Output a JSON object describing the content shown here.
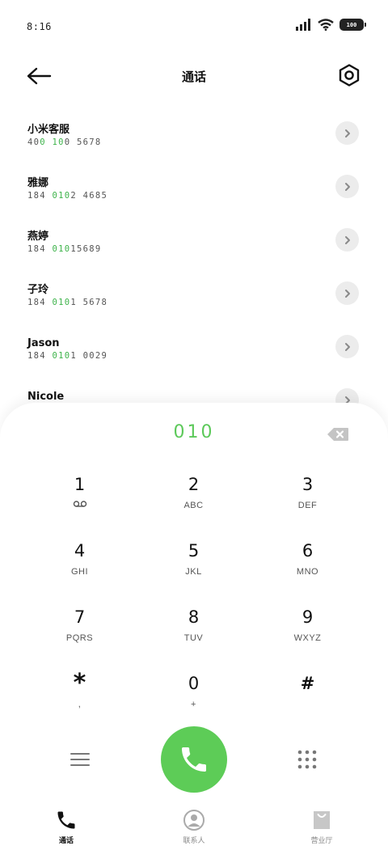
{
  "status": {
    "time": "8:16",
    "battery": "100"
  },
  "header": {
    "title": "通话"
  },
  "contacts": [
    {
      "name": "小米客服",
      "number_pre": "40",
      "number_hl": "0 10",
      "number_post": "0 5678"
    },
    {
      "name": "雅娜",
      "number_pre": "184 ",
      "number_hl": "010",
      "number_post": "2 4685"
    },
    {
      "name": "燕婷",
      "number_pre": "184 ",
      "number_hl": "010",
      "number_post": "15689"
    },
    {
      "name": "子玲",
      "number_pre": "184 ",
      "number_hl": "010",
      "number_post": "1 5678"
    },
    {
      "name": "Jason",
      "number_pre": "184 ",
      "number_hl": "010",
      "number_post": "1 0029"
    },
    {
      "name": "Nicole",
      "number_pre": "",
      "number_hl": "",
      "number_post": ""
    }
  ],
  "dialer": {
    "display": "010",
    "keys": [
      {
        "digit": "1",
        "letters": ""
      },
      {
        "digit": "2",
        "letters": "ABC"
      },
      {
        "digit": "3",
        "letters": "DEF"
      },
      {
        "digit": "4",
        "letters": "GHI"
      },
      {
        "digit": "5",
        "letters": "JKL"
      },
      {
        "digit": "6",
        "letters": "MNO"
      },
      {
        "digit": "7",
        "letters": "PQRS"
      },
      {
        "digit": "8",
        "letters": "TUV"
      },
      {
        "digit": "9",
        "letters": "WXYZ"
      },
      {
        "digit": "*",
        "letters": ","
      },
      {
        "digit": "0",
        "letters": "+"
      },
      {
        "digit": "#",
        "letters": ""
      }
    ]
  },
  "nav": {
    "calls": "通话",
    "contacts": "联系人",
    "store": "营业厅"
  },
  "colors": {
    "accent": "#5dcc57",
    "highlight": "#3db34a"
  },
  "icons": {
    "voicemail": "voicemail-icon",
    "call": "phone-icon",
    "menu": "menu-icon",
    "keypad": "keypad-icon",
    "back": "arrow-left-icon",
    "settings": "hexagon-settings-icon",
    "backspace": "backspace-icon"
  }
}
